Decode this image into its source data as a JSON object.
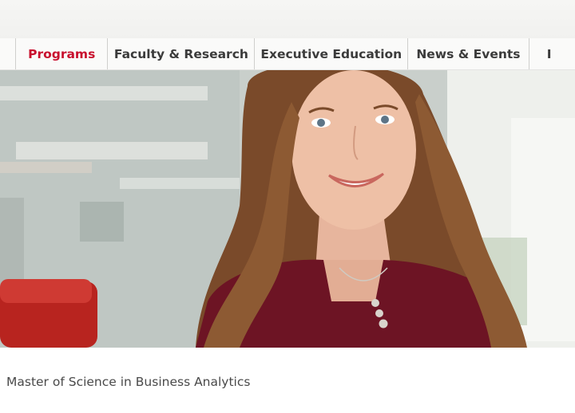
{
  "nav": {
    "items": [
      {
        "label": "Programs",
        "active": true
      },
      {
        "label": "Faculty & Research",
        "active": false
      },
      {
        "label": "Executive Education",
        "active": false
      },
      {
        "label": "News & Events",
        "active": false
      },
      {
        "label": "I",
        "active": false
      }
    ]
  },
  "hero": {
    "image": "smiling-woman-portrait-photo"
  },
  "caption": {
    "text": "Master of Science in Business Analytics"
  },
  "colors": {
    "accent": "#c8102e",
    "nav_text": "#3b3b3b",
    "caption_text": "#4a4a4a"
  }
}
